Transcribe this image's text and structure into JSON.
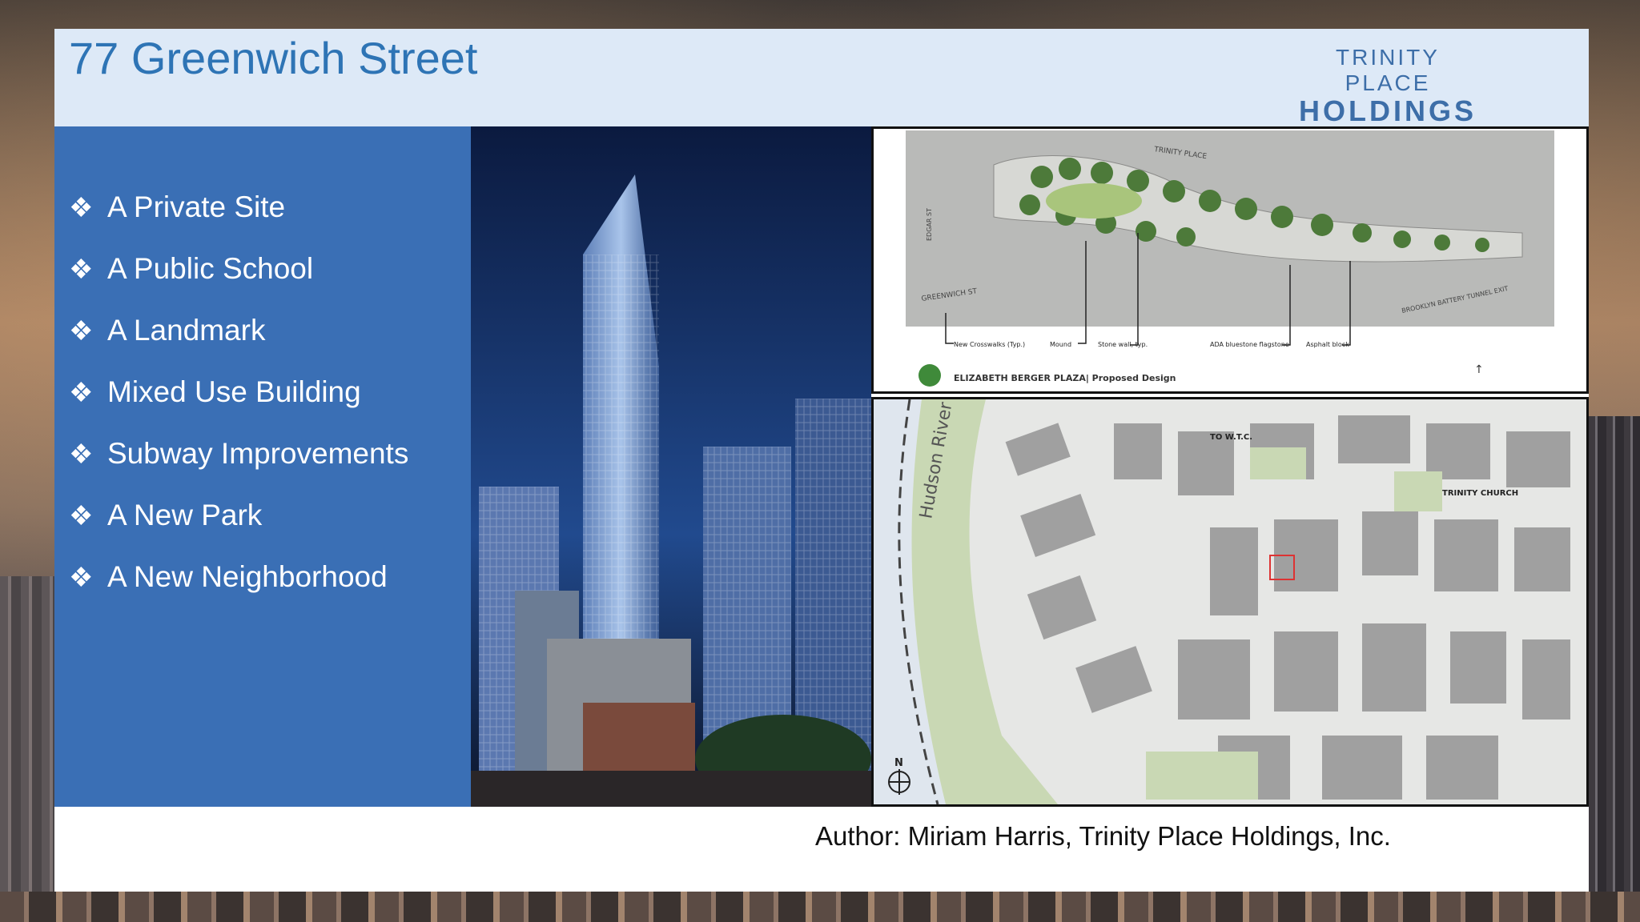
{
  "slide": {
    "title": "77 Greenwich Street",
    "logo": {
      "line1": "TRINITY PLACE",
      "line2": "HOLDINGS"
    },
    "bullet_icon": "diamond-bullet-icon",
    "bullets": [
      "A Private Site",
      "A Public School",
      "A Landmark",
      "Mixed Use Building",
      "Subway Improvements",
      "A New Park",
      "A New Neighborhood"
    ],
    "author": "Author:  Miriam Harris, Trinity Place Holdings, Inc."
  },
  "plaza_plan": {
    "caption": "ELIZABETH BERGER PLAZA| Proposed Design",
    "streets": [
      "TRINITY PLACE",
      "GREENWICH ST",
      "EDGAR ST",
      "BROOKLYN BATTERY TUNNEL EXIT"
    ],
    "callouts": [
      "New Crosswalks (Typ.)",
      "Mound",
      "Stone wall, typ.",
      "ADA bluestone flagstone",
      "Asphalt block"
    ]
  },
  "site_map": {
    "labels": [
      "Hudson River",
      "TO W.T.C.",
      "TRINITY CHURCH"
    ],
    "compass": "N"
  },
  "colors": {
    "header_bg": "#dde9f7",
    "title": "#2e74b5",
    "panel": "#3a6fb5",
    "logo": "#3d6ea8"
  }
}
